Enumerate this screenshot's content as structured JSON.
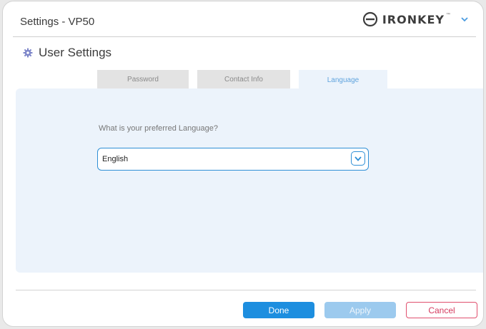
{
  "window": {
    "title": "Settings - VP50"
  },
  "brand": {
    "name": "IRONKEY",
    "trademark": "™",
    "logo_icon": "ironkey-logo-icon",
    "menu_icon": "chevron-down-icon"
  },
  "section": {
    "title": "User Settings",
    "icon": "gear-icon"
  },
  "tabs": [
    {
      "label": "Password",
      "active": false
    },
    {
      "label": "Contact Info",
      "active": false
    },
    {
      "label": "Language",
      "active": true
    }
  ],
  "language": {
    "question": "What is your preferred Language?",
    "selected": "English",
    "toggle_icon": "chevron-down-icon"
  },
  "buttons": {
    "done": "Done",
    "apply": "Apply",
    "cancel": "Cancel"
  },
  "colors": {
    "accent": "#1d8edf",
    "panel": "#ecf3fb",
    "cancel": "#d53a5e",
    "apply_disabled": "#9ccaee"
  }
}
